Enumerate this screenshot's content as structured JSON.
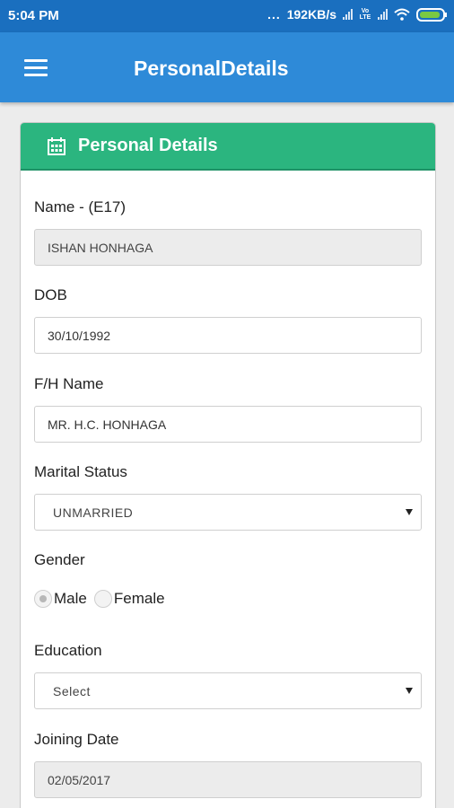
{
  "status_bar": {
    "time": "5:04 PM",
    "network_speed": "192KB/s",
    "dots": "...",
    "volte": "Vo LTE"
  },
  "app_bar": {
    "title": "PersonalDetails",
    "icon": "menu-icon",
    "color": "#2e8ad8"
  },
  "card": {
    "title": "Personal Details",
    "icon": "calendar-icon",
    "header_color": "#2bb57f"
  },
  "fields": {
    "name_label": "Name - (E17)",
    "name_value": "ISHAN HONHAGA",
    "dob_label": "DOB",
    "dob_value": "30/10/1992",
    "fh_name_label": "F/H Name",
    "fh_name_value": "MR. H.C. HONHAGA",
    "marital_label": "Marital Status",
    "marital_value": "UNMARRIED",
    "gender_label": "Gender",
    "gender_options": [
      "Male",
      "Female"
    ],
    "gender_selected": "Male",
    "education_label": "Education",
    "education_value": "Select",
    "joining_label": "Joining Date",
    "joining_value": "02/05/2017"
  }
}
